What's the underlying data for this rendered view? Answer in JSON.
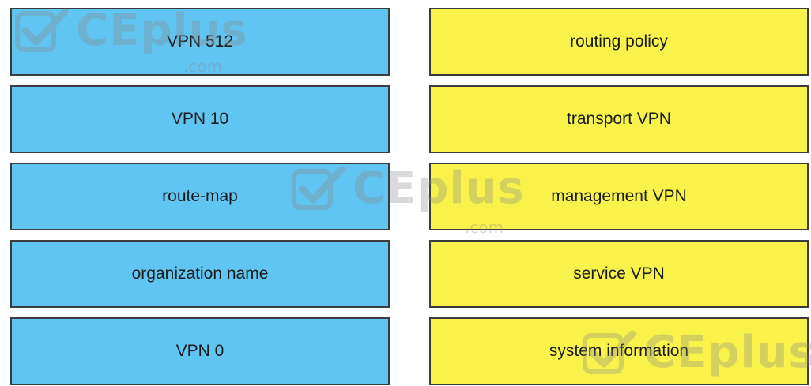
{
  "left_items": [
    {
      "label": "VPN 512"
    },
    {
      "label": "VPN 10"
    },
    {
      "label": "route-map"
    },
    {
      "label": "organization name"
    },
    {
      "label": "VPN 0"
    }
  ],
  "right_items": [
    {
      "label": "routing policy"
    },
    {
      "label": "transport VPN"
    },
    {
      "label": "management VPN"
    },
    {
      "label": "service VPN"
    },
    {
      "label": "system information"
    }
  ],
  "watermark": {
    "text": "CEplus",
    "suffix": ".com"
  },
  "colors": {
    "left_box": "#61c5f1",
    "right_box": "#f8f24a",
    "border": "#3b3b3b"
  }
}
